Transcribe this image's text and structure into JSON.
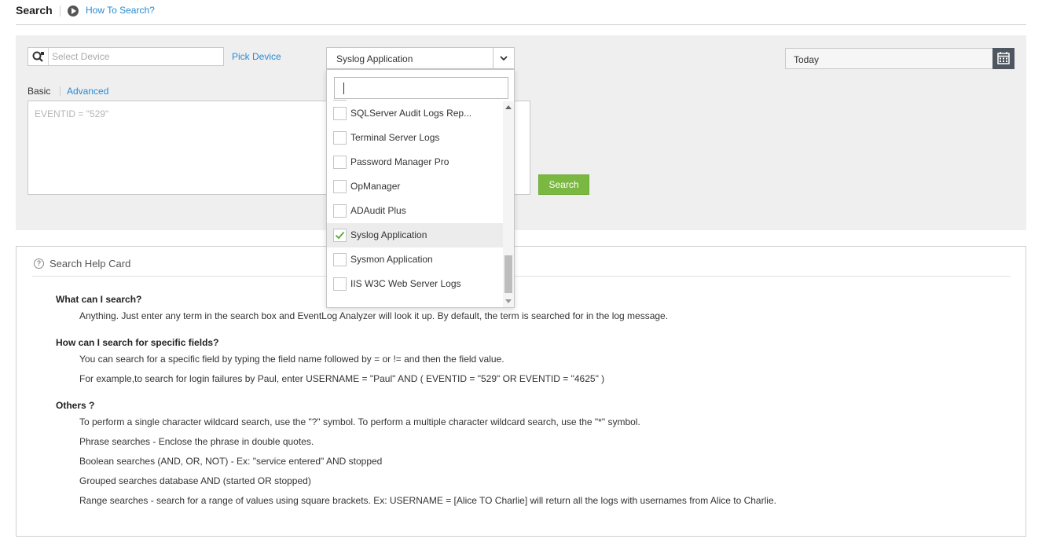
{
  "header": {
    "title": "Search",
    "how_to_link": "How To Search?"
  },
  "device": {
    "placeholder": "Select Device",
    "pick_label": "Pick Device"
  },
  "app_select": {
    "selected": "Syslog Application"
  },
  "date": {
    "value": "Today"
  },
  "modes": {
    "basic": "Basic",
    "advanced": "Advanced"
  },
  "query": {
    "placeholder": "EVENTID = \"529\""
  },
  "search_button": "Search",
  "dropdown": {
    "filter_value": "",
    "partial_item": "",
    "items": [
      {
        "label": "SQLServer Audit Logs Rep...",
        "checked": false
      },
      {
        "label": "Terminal Server Logs",
        "checked": false
      },
      {
        "label": "Password Manager Pro",
        "checked": false
      },
      {
        "label": "OpManager",
        "checked": false
      },
      {
        "label": "ADAudit Plus",
        "checked": false
      },
      {
        "label": "Syslog Application",
        "checked": true
      },
      {
        "label": "Sysmon Application",
        "checked": false
      },
      {
        "label": "IIS W3C Web Server Logs",
        "checked": false
      }
    ]
  },
  "help": {
    "title": "Search Help Card",
    "sections": [
      {
        "question": "What can I search?",
        "answers": [
          "Anything. Just enter any term in the search box and EventLog Analyzer will look it up. By default, the term is searched for in the log message."
        ]
      },
      {
        "question": "How can I search for specific fields?",
        "answers": [
          "You can search for a specific field by typing the field name followed by = or != and then the field value.",
          "For example,to search for login failures by Paul, enter USERNAME = \"Paul\" AND ( EVENTID = \"529\" OR EVENTID = \"4625\" )"
        ]
      },
      {
        "question": "Others ?",
        "answers": [
          "To perform a single character wildcard search, use the \"?\" symbol. To perform a multiple character wildcard search, use the \"*\" symbol.",
          "Phrase searches - Enclose the phrase in double quotes.",
          "Boolean searches (AND, OR, NOT) - Ex: \"service entered\" AND stopped",
          "Grouped searches database AND (started OR stopped)",
          "Range searches - search for a range of values using square brackets. Ex: USERNAME = [Alice TO Charlie] will return all the logs with usernames from Alice to Charlie."
        ]
      }
    ]
  },
  "icons": {
    "search_device": "device-search-icon",
    "how_to": "play-circle-icon",
    "chevron": "chevron-down-icon",
    "calendar": "calendar-icon",
    "help": "question-circle-icon",
    "check": "check-icon"
  },
  "colors": {
    "link": "#2a8ad1",
    "search_button": "#7bb841",
    "panel_bg": "#efeff0",
    "calendar_button": "#4e5660",
    "check": "#5aa832"
  }
}
